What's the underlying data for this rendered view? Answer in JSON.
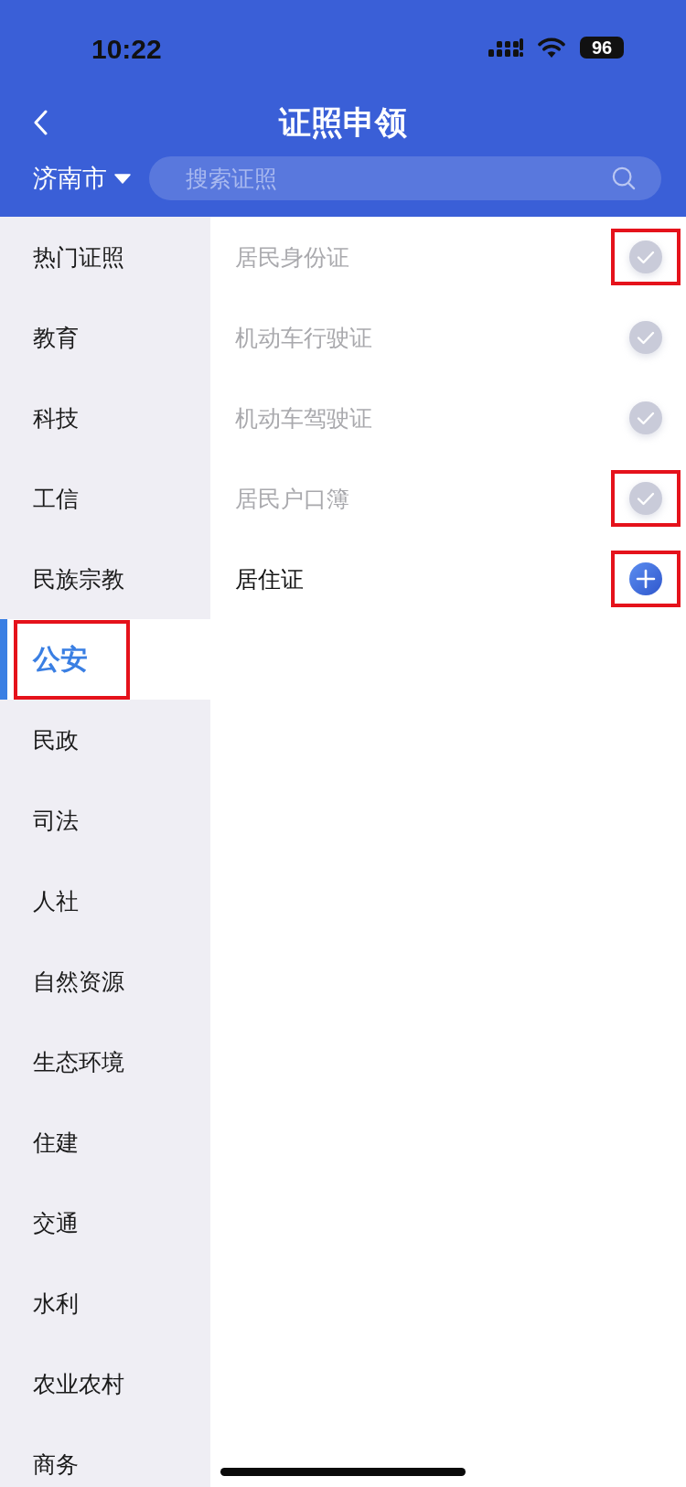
{
  "status_bar": {
    "time": "10:22",
    "battery": "96"
  },
  "header": {
    "title": "证照申领",
    "city": "济南市",
    "search": {
      "placeholder": "搜索证照"
    }
  },
  "sidebar": {
    "items": [
      {
        "label": "热门证照",
        "selected": false,
        "highlighted": false
      },
      {
        "label": "教育",
        "selected": false,
        "highlighted": false
      },
      {
        "label": "科技",
        "selected": false,
        "highlighted": false
      },
      {
        "label": "工信",
        "selected": false,
        "highlighted": false
      },
      {
        "label": "民族宗教",
        "selected": false,
        "highlighted": false
      },
      {
        "label": "公安",
        "selected": true,
        "highlighted": true
      },
      {
        "label": "民政",
        "selected": false,
        "highlighted": false
      },
      {
        "label": "司法",
        "selected": false,
        "highlighted": false
      },
      {
        "label": "人社",
        "selected": false,
        "highlighted": false
      },
      {
        "label": "自然资源",
        "selected": false,
        "highlighted": false
      },
      {
        "label": "生态环境",
        "selected": false,
        "highlighted": false
      },
      {
        "label": "住建",
        "selected": false,
        "highlighted": false
      },
      {
        "label": "交通",
        "selected": false,
        "highlighted": false
      },
      {
        "label": "水利",
        "selected": false,
        "highlighted": false
      },
      {
        "label": "农业农村",
        "selected": false,
        "highlighted": false
      },
      {
        "label": "商务",
        "selected": false,
        "highlighted": false
      }
    ]
  },
  "certificates": [
    {
      "label": "居民身份证",
      "added": true,
      "highlighted": true
    },
    {
      "label": "机动车行驶证",
      "added": true,
      "highlighted": false
    },
    {
      "label": "机动车驾驶证",
      "added": true,
      "highlighted": false
    },
    {
      "label": "居民户口簿",
      "added": true,
      "highlighted": true
    },
    {
      "label": "居住证",
      "added": false,
      "highlighted": true
    }
  ]
}
